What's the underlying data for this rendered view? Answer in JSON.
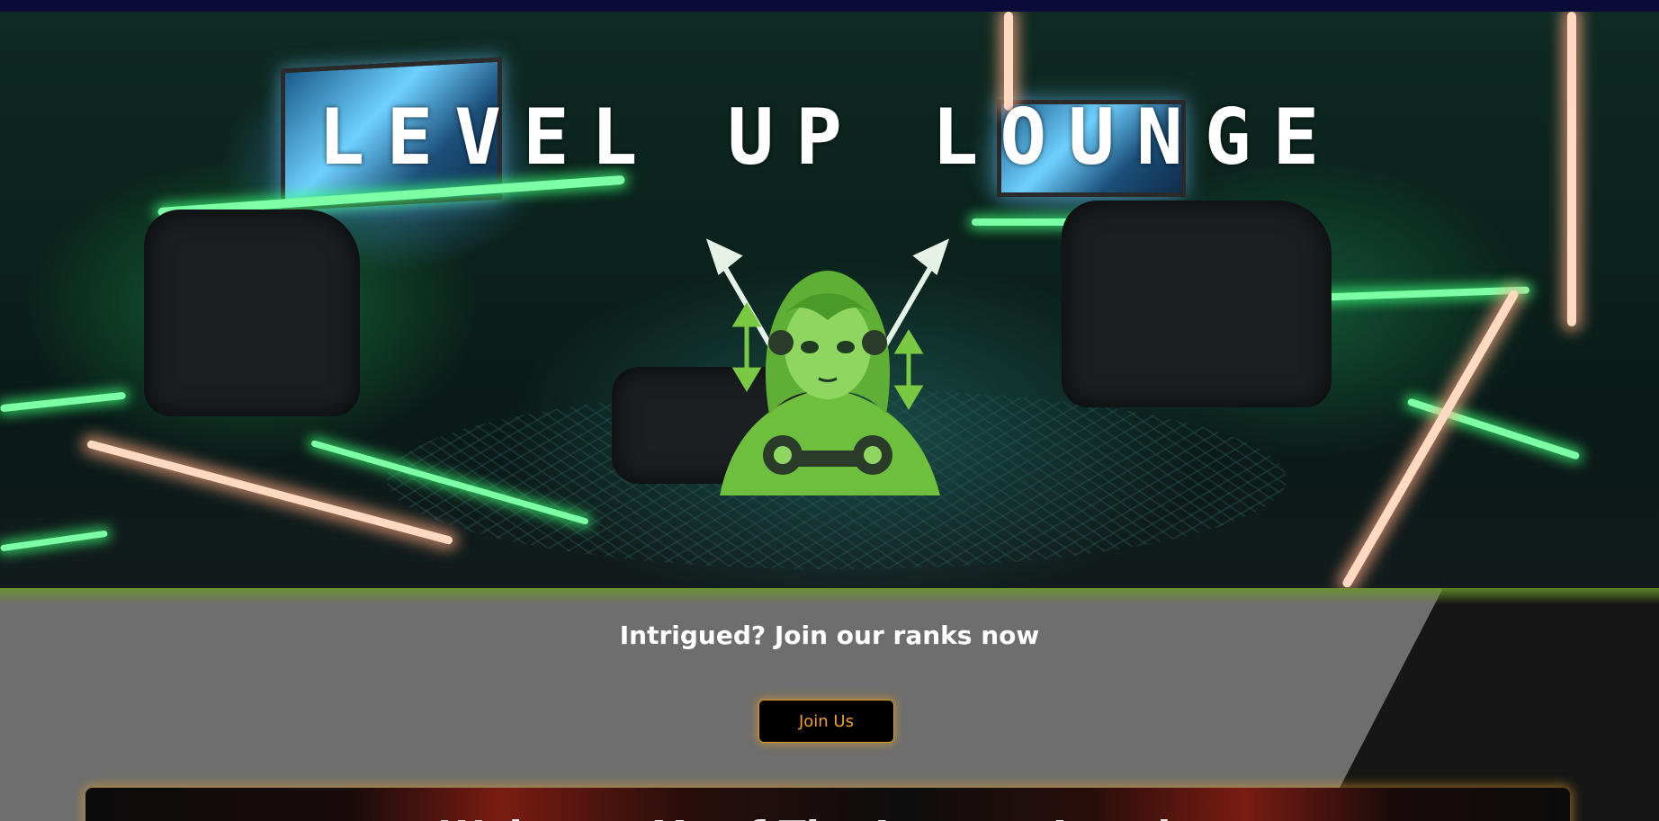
{
  "hero": {
    "title": "LEVEL UP LOUNGE"
  },
  "cta": {
    "heading": "Intrigued? Join our ranks now",
    "button_label": "Join Us"
  },
  "welcome": {
    "title": "Welcome Ye of The Lounge Loyalty"
  },
  "colors": {
    "top_bar": "#0b0b3a",
    "neon_green": "#3cff78",
    "cta_gray": "#6e6e6e",
    "button_text": "#f0a030",
    "button_glow": "#e6a028"
  },
  "icons": {
    "logo": "green-haired-gamer-girl-mascot"
  }
}
